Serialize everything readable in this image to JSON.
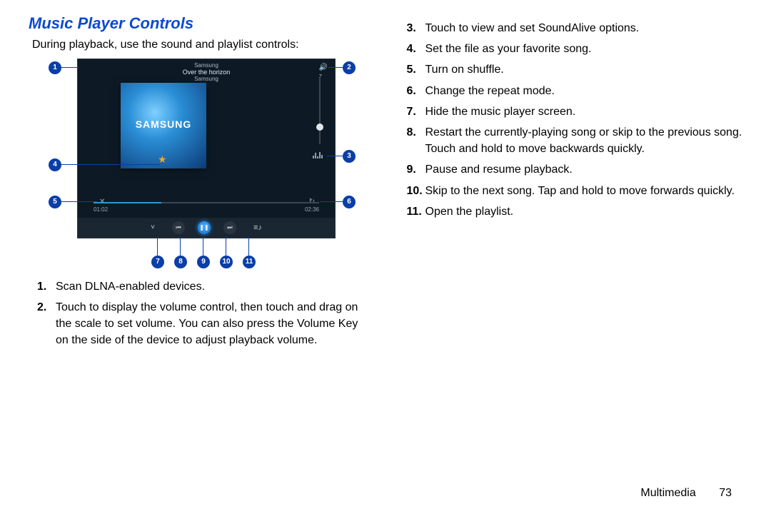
{
  "heading": "Music Player Controls",
  "intro": "During playback, use the sound and playlist controls:",
  "screenshot": {
    "artist_top": "Samsung",
    "track_title": "Over the horizon",
    "artist_bottom": "Samsung",
    "album_brand": "SAMSUNG",
    "time_elapsed": "01:02",
    "time_total": "02:36",
    "vol_max": "7"
  },
  "callouts": {
    "c1": "1",
    "c2": "2",
    "c3": "3",
    "c4": "4",
    "c5": "5",
    "c6": "6",
    "c7": "7",
    "c8": "8",
    "c9": "9",
    "c10": "10",
    "c11": "11"
  },
  "left_list": [
    {
      "n": "1.",
      "t": "Scan DLNA-enabled devices."
    },
    {
      "n": "2.",
      "t": "Touch to display the volume control, then touch and drag on the scale to set volume. You can also press the Volume Key on the side of the device to adjust playback volume."
    }
  ],
  "right_list": [
    {
      "n": "3.",
      "t": "Touch to view and set SoundAlive options."
    },
    {
      "n": "4.",
      "t": "Set the file as your favorite song."
    },
    {
      "n": "5.",
      "t": "Turn on shuffle."
    },
    {
      "n": "6.",
      "t": "Change the repeat mode."
    },
    {
      "n": "7.",
      "t": "Hide the music player screen."
    },
    {
      "n": "8.",
      "t": "Restart the currently-playing song or skip to the previous song. Touch and hold to move backwards quickly."
    },
    {
      "n": "9.",
      "t": "Pause and resume playback."
    },
    {
      "n": "10.",
      "t": "Skip to the next song. Tap and hold to move forwards quickly."
    },
    {
      "n": "11.",
      "t": "Open the playlist."
    }
  ],
  "footer": {
    "section": "Multimedia",
    "page": "73"
  }
}
